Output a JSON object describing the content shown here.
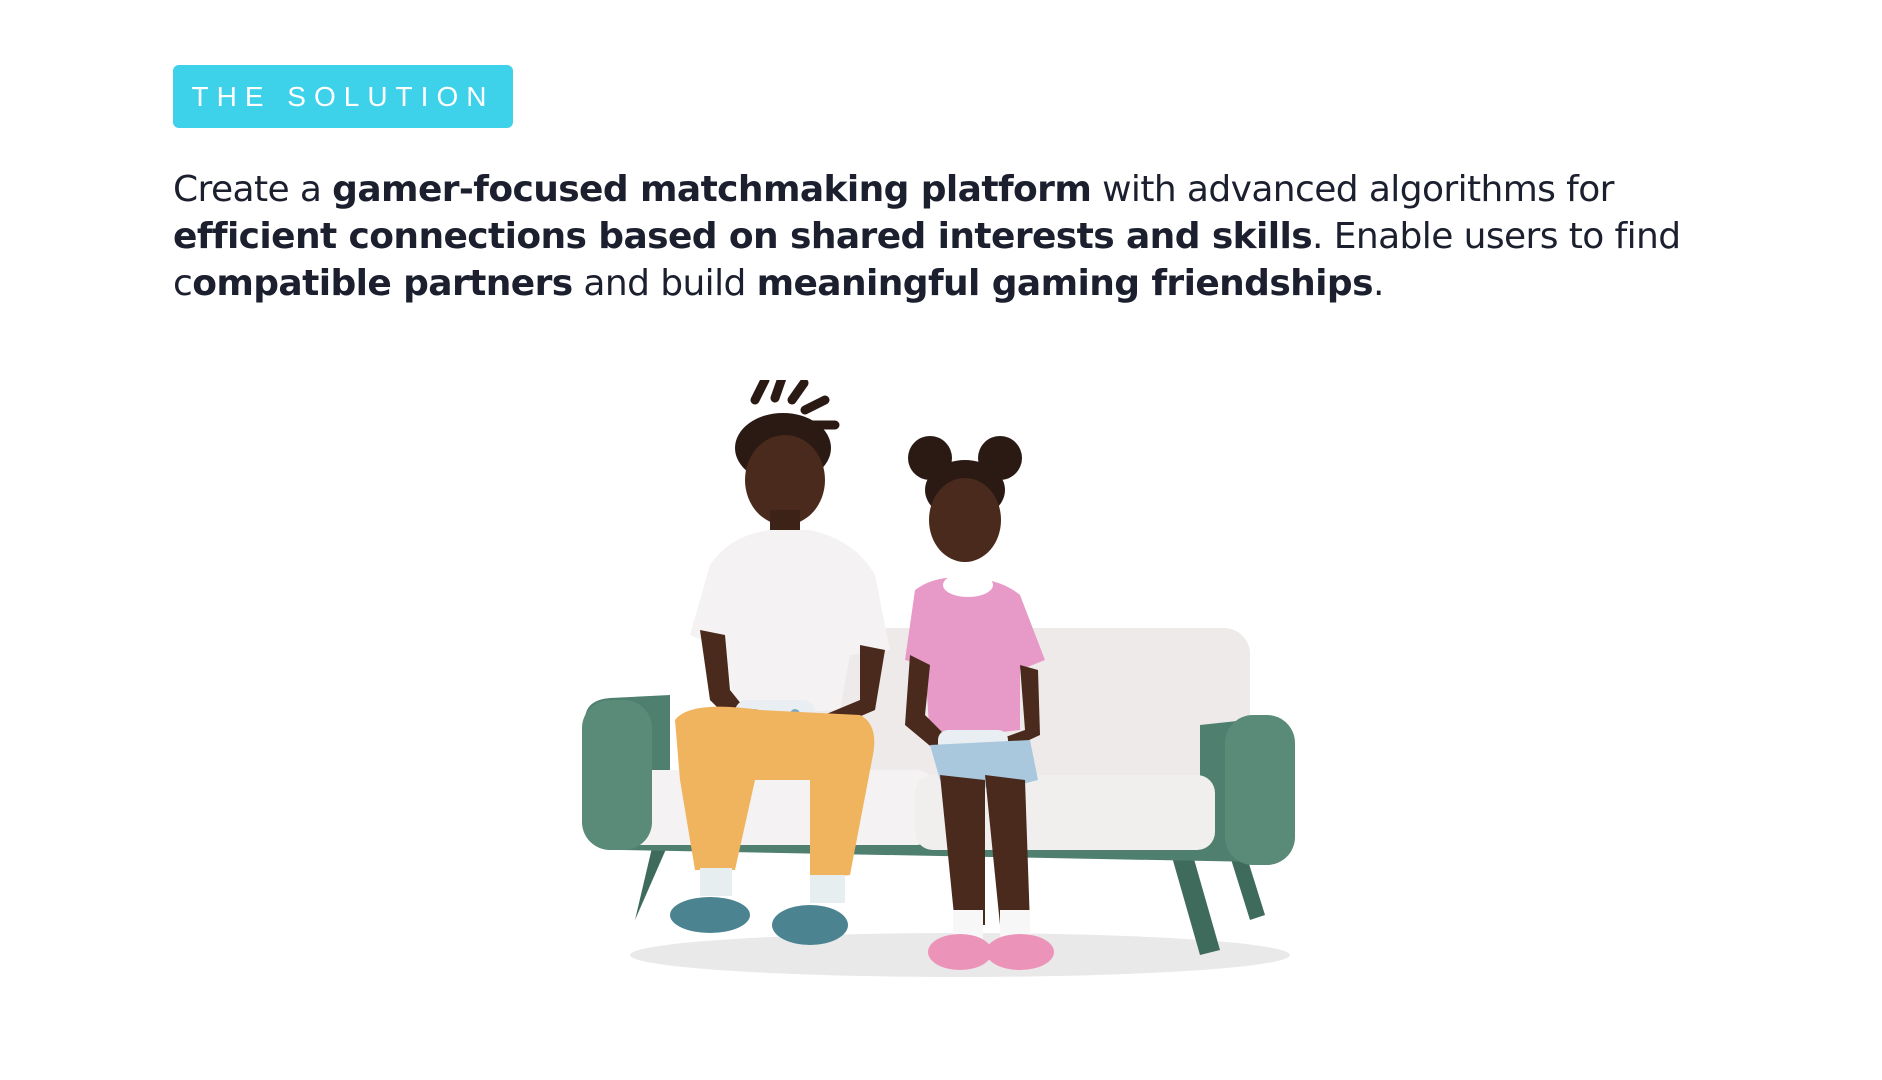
{
  "badge": {
    "label": "THE SOLUTION"
  },
  "description": {
    "s1": "Create a ",
    "b1": "gamer-focused matchmaking platform",
    "s2": " with advanced algorithms for ",
    "b2": "efficient connections based on shared interests and skills",
    "s3": ". Enable users to find c",
    "b3": "ompatible partners",
    "s4": " and build ",
    "b4": "meaningful gaming friendships",
    "s5": "."
  },
  "illustration": {
    "icon": "two-gamers-on-sofa-illustration",
    "colors": {
      "sofa": "#4f7f6e",
      "cushion": "#f1eeee",
      "skin": "#4a2a1c",
      "man_shirt": "#f4f2f2",
      "man_pants": "#f0b45e",
      "girl_dress": "#e79ac7",
      "shorts": "#a9c8de",
      "man_shoes": "#4b8391",
      "girl_shoes": "#eb93b8"
    }
  }
}
